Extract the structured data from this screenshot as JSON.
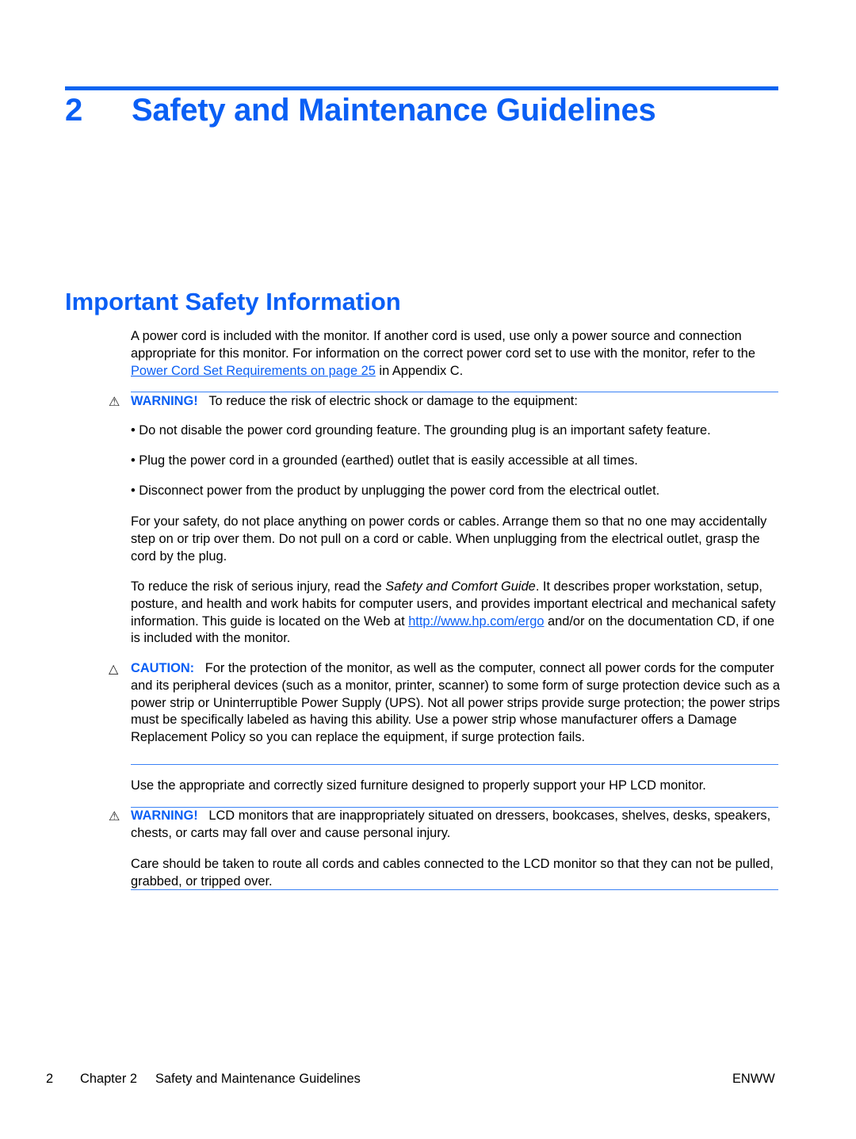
{
  "chapter": {
    "number": "2",
    "title": "Safety and Maintenance Guidelines"
  },
  "section": {
    "title": "Important Safety Information"
  },
  "intro": {
    "before_link": "A power cord is included with the monitor. If another cord is used, use only a power source and connection appropriate for this monitor. For information on the correct power cord set to use with the monitor, refer to the ",
    "link": "Power Cord Set Requirements on page 25",
    "after_link": " in Appendix C."
  },
  "warning1": {
    "icon": "warning-triangle-icon",
    "label": "WARNING!",
    "text": "To reduce the risk of electric shock or damage to the equipment:",
    "bullets": [
      "• Do not disable the power cord grounding feature. The grounding plug is an important safety feature.",
      "• Plug the power cord in a grounded (earthed) outlet that is easily accessible at all times.",
      "• Disconnect power from the product by unplugging the power cord from the electrical outlet."
    ],
    "para1": "For your safety, do not place anything on power cords or cables. Arrange them so that no one may accidentally step on or trip over them. Do not pull on a cord or cable. When unplugging from the electrical outlet, grasp the cord by the plug.",
    "para2_before": "To reduce the risk of serious injury, read the ",
    "para2_italic": "Safety and Comfort Guide",
    "para2_mid": ". It describes proper workstation, setup, posture, and health and work habits for computer users, and provides important electrical and mechanical safety information. This guide is located on the Web at ",
    "para2_link": "http://www.hp.com/ergo",
    "para2_after": " and/or on the documentation CD, if one is included with the monitor."
  },
  "caution": {
    "icon": "caution-triangle-icon",
    "label": "CAUTION:",
    "text": "For the protection of the monitor, as well as the computer, connect all power cords for the computer and its peripheral devices (such as a monitor, printer, scanner) to some form of surge protection device such as a power strip or Uninterruptible Power Supply (UPS). Not all power strips provide surge protection; the power strips must be specifically labeled as having this ability. Use a power strip whose manufacturer offers a Damage Replacement Policy so you can replace the equipment, if surge protection fails."
  },
  "furniture": "Use the appropriate and correctly sized furniture designed to properly support your HP LCD monitor.",
  "warning2": {
    "icon": "warning-triangle-icon",
    "label": "WARNING!",
    "text": "LCD monitors that are inappropriately situated on dressers, bookcases, shelves, desks, speakers, chests, or carts may fall over and cause personal injury.",
    "para": "Care should be taken to route all cords and cables connected to the LCD monitor so that they can not be pulled, grabbed, or tripped over."
  },
  "footer": {
    "page": "2",
    "chapter_label": "Chapter 2",
    "chapter_title": "Safety and Maintenance Guidelines",
    "locale": "ENWW"
  }
}
